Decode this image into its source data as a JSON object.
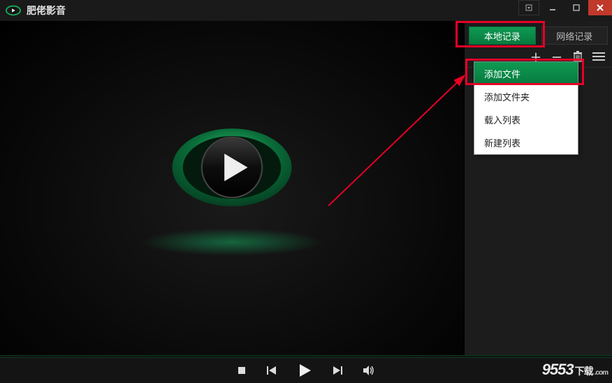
{
  "app": {
    "title": "肥佬影音"
  },
  "sidebar": {
    "tabs": [
      {
        "label": "本地记录",
        "active": true
      },
      {
        "label": "网络记录",
        "active": false
      }
    ]
  },
  "icons": {
    "plus": "＋",
    "minus": "－"
  },
  "menu": {
    "items": [
      {
        "label": "添加文件",
        "active": true
      },
      {
        "label": "添加文件夹",
        "active": false
      },
      {
        "label": "载入列表",
        "active": false
      },
      {
        "label": "新建列表",
        "active": false
      }
    ]
  },
  "watermark": {
    "num": "9553",
    "zh": "下载",
    "com": ".com"
  }
}
